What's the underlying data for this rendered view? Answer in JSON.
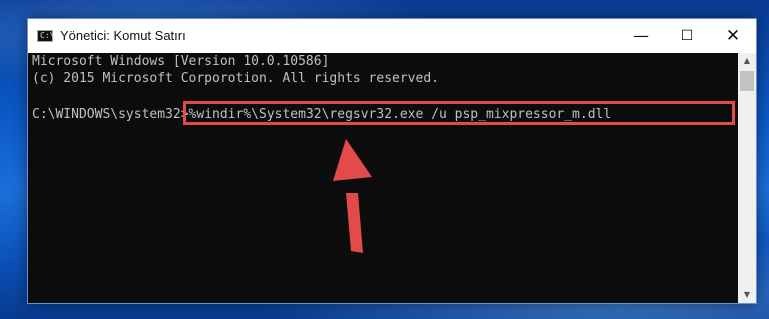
{
  "window": {
    "title": "Yönetici: Komut Satırı",
    "icon": "cmd-icon",
    "controls": {
      "minimize": "—",
      "maximize": "☐",
      "close": "✕"
    }
  },
  "console": {
    "lines": [
      "Microsoft Windows [Version 10.0.10586]",
      "(c) 2015 Microsoft Corporotion. All rights reserved."
    ],
    "prompt": "C:\\WINDOWS\\system32>",
    "command": "%windir%\\System32\\regsvr32.exe /u psp_mixpressor_m.dll"
  },
  "annotation": {
    "highlight_color": "#e34b4b",
    "arrow_color": "#e34b4b",
    "arrow_direction": "up"
  },
  "colors": {
    "console_bg": "#0c0c0c",
    "console_text": "#c0c0c0",
    "desktop_bg": "#0b58c6"
  }
}
